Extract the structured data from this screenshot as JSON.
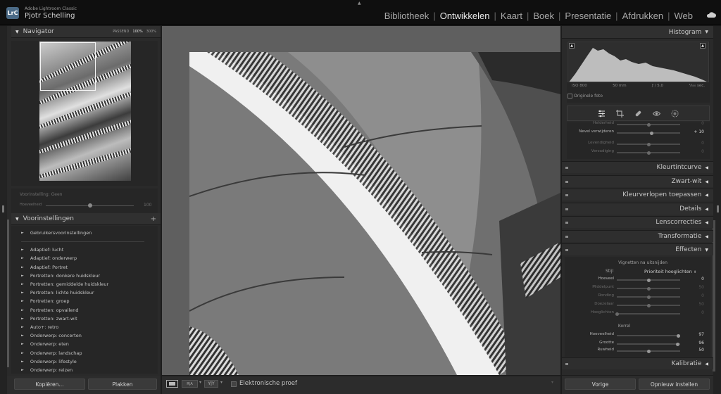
{
  "app": {
    "logo": "LrC",
    "name": "Adobe Lightroom Classic",
    "user": "Pjotr Schelling"
  },
  "modules": [
    "Bibliotheek",
    "Ontwikkelen",
    "Kaart",
    "Boek",
    "Presentatie",
    "Afdrukken",
    "Web"
  ],
  "active_module": "Ontwikkelen",
  "module_sep": "|",
  "navigator": {
    "title": "Navigator",
    "zoom_options": [
      "PASSEND",
      "100%",
      "300%"
    ],
    "active_zoom": "100%"
  },
  "preset_info": {
    "label": "Voorinstelling: Geen",
    "amount_label": "Hoeveelheid",
    "amount_value": "100"
  },
  "presets": {
    "title": "Voorinstellingen",
    "add": "+",
    "groups": [
      "Gebruikersvoorinstellingen",
      "Adaptief: lucht",
      "Adaptief: onderwerp",
      "Adaptief: Portret",
      "Portretten: donkere huidskleur",
      "Portretten: gemiddelde huidskleur",
      "Portretten: lichte huidskleur",
      "Portretten: groep",
      "Portretten: opvallend",
      "Portretten: zwart-wit",
      "Auto+: retro",
      "Onderwerp: concerten",
      "Onderwerp: eten",
      "Onderwerp: landschap",
      "Onderwerp: lifestyle",
      "Onderwerp: reizen"
    ]
  },
  "left_buttons": {
    "copy": "Kopiëren...",
    "paste": "Plakken"
  },
  "toolbar": {
    "ra_label": "R|A",
    "yy_label": "Y|Y",
    "proof_label": "Elektronische proef"
  },
  "histogram": {
    "title": "Histogram",
    "meta": {
      "iso": "ISO 800",
      "focal": "50 mm",
      "aperture": "ƒ / 5,0",
      "shutter": "¹⁄₅₀₀ sec."
    },
    "original_photo": "Originele foto"
  },
  "basic_sliders": [
    {
      "label": "Helderheid",
      "value": "0",
      "pos": 0.5,
      "dim": true
    },
    {
      "label": "Nevel verwijderen",
      "value": "+ 10",
      "pos": 0.55,
      "dim": false
    },
    {
      "label": "Levendigheid",
      "value": "0",
      "pos": 0.5,
      "dim": true
    },
    {
      "label": "Verzadiging",
      "value": "0",
      "pos": 0.5,
      "dim": true
    }
  ],
  "sections": [
    "Kleurtintcurve",
    "Zwart-wit",
    "Kleurverlopen toepassen",
    "Details",
    "Lenscorrecties",
    "Transformatie",
    "Effecten",
    "Kalibratie"
  ],
  "effects": {
    "vignette_title": "Vignetten na uitsnijden",
    "style_label": "Stijl",
    "style_value": "Prioriteit hooglichten",
    "vignette_sliders": [
      {
        "label": "Hoeveel",
        "value": "0",
        "pos": 0.5,
        "dim": false
      },
      {
        "label": "Middelpunt",
        "value": "50",
        "pos": 0.5,
        "dim": true
      },
      {
        "label": "Ronding",
        "value": "0",
        "pos": 0.5,
        "dim": true
      },
      {
        "label": "Doezelaar",
        "value": "50",
        "pos": 0.5,
        "dim": true
      },
      {
        "label": "Hooglichten",
        "value": "0",
        "pos": 0.0,
        "dim": true
      }
    ],
    "grain_title": "Korrel",
    "grain_sliders": [
      {
        "label": "Hoeveelheid",
        "value": "97",
        "pos": 0.97,
        "dim": false
      },
      {
        "label": "Grootte",
        "value": "96",
        "pos": 0.96,
        "dim": false
      },
      {
        "label": "Ruwheid",
        "value": "50",
        "pos": 0.5,
        "dim": false
      }
    ]
  },
  "right_buttons": {
    "previous": "Vorige",
    "reset": "Opnieuw instellen"
  },
  "icons": {
    "basic": "sliders-icon",
    "crop": "crop-icon",
    "heal": "bandage-icon",
    "redeye": "eye-icon",
    "mask": "mask-icon",
    "cloud": "cloud-icon"
  }
}
